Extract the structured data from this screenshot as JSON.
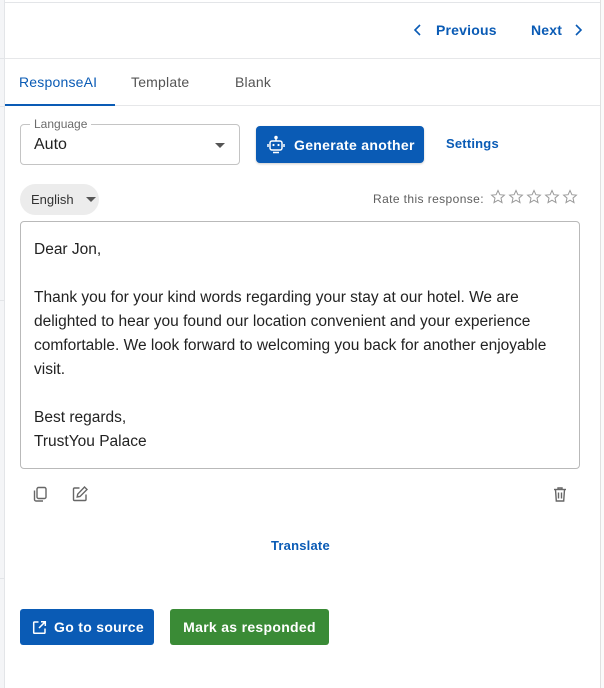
{
  "nav": {
    "previous_label": "Previous",
    "next_label": "Next"
  },
  "tabs": [
    {
      "label": "ResponseAI",
      "active": true
    },
    {
      "label": "Template",
      "active": false
    },
    {
      "label": "Blank",
      "active": false
    }
  ],
  "language_select": {
    "label": "Language",
    "value": "Auto"
  },
  "toolbar": {
    "generate_label": "Generate another",
    "settings_label": "Settings"
  },
  "output_language": {
    "value": "English"
  },
  "rating": {
    "label": "Rate this response:",
    "max_stars": 5,
    "value": 0
  },
  "response": {
    "greeting": "Dear Jon,",
    "body": "Thank you for your kind words regarding your stay at our hotel. We are delighted to hear you found our location convenient and your experience comfortable. We look forward to welcoming you back for another enjoyable visit.",
    "closing": "Best regards,",
    "signature": "TrustYou Palace"
  },
  "actions": {
    "translate_label": "Translate",
    "go_to_source_label": "Go to source",
    "mark_responded_label": "Mark as responded"
  },
  "colors": {
    "primary": "#0a5bb5",
    "success": "#3a8b36",
    "chip_bg": "#ececec",
    "border": "#b9b9b9"
  }
}
